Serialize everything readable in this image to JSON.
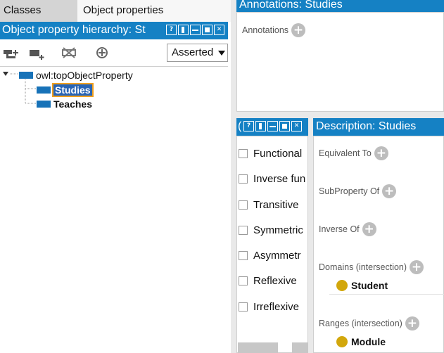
{
  "tabs": {
    "classes": "Classes",
    "object_properties": "Object properties"
  },
  "hierarchy": {
    "title": "Object property hierarchy: St",
    "view_select_value": "Asserted",
    "toolbar_icons": [
      "add-subproperty-icon",
      "add-sibling-icon",
      "delete-property-icon",
      "target-icon"
    ],
    "tree": {
      "root": "owl:topObjectProperty",
      "children": [
        "Studies",
        "Teaches"
      ],
      "selected": "Studies"
    }
  },
  "annotations": {
    "title": "Annotations: Studies",
    "label": "Annotations"
  },
  "characteristics": {
    "title": "(",
    "items": [
      {
        "label": "Functional",
        "checked": false
      },
      {
        "label": "Inverse fun",
        "checked": false
      },
      {
        "label": "Transitive",
        "checked": false
      },
      {
        "label": "Symmetric",
        "checked": false
      },
      {
        "label": "Asymmetr",
        "checked": false
      },
      {
        "label": "Reflexive",
        "checked": false
      },
      {
        "label": "Irreflexive",
        "checked": false
      }
    ]
  },
  "description": {
    "title": "Description: Studies",
    "sections": {
      "equivalent_to": "Equivalent To",
      "subproperty_of": "SubProperty Of",
      "inverse_of": "Inverse Of",
      "domains": "Domains (intersection)",
      "ranges": "Ranges (intersection)"
    },
    "domains": [
      "Student"
    ],
    "ranges": [
      "Module"
    ]
  },
  "colors": {
    "title_bar": "#1581c4",
    "property_icon": "#1772b8",
    "class_dot": "#d2a70c",
    "selection": "#2864b4",
    "selection_outline": "#f0a020"
  }
}
